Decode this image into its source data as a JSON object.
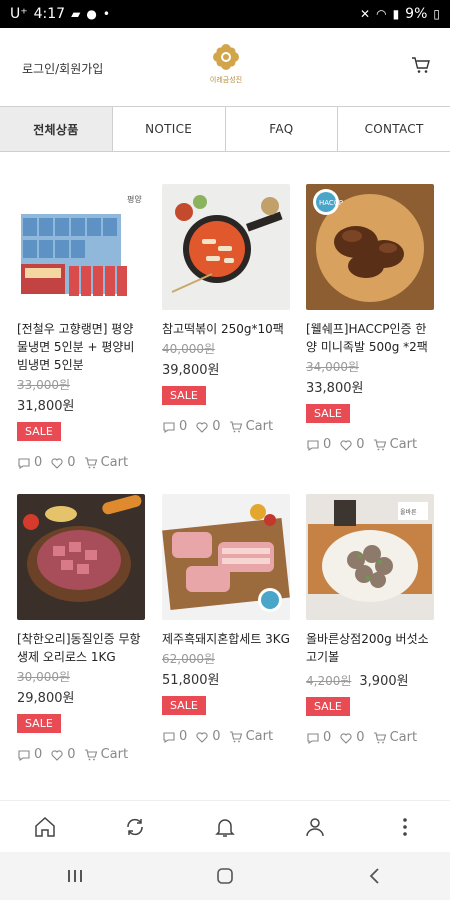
{
  "status_bar": {
    "carrier": "U⁺",
    "time": "4:17",
    "battery": "9%"
  },
  "header": {
    "login_label": "로그인/회원가입",
    "logo_text": "이레금성진"
  },
  "tabs": [
    {
      "label": "전체상품",
      "active": true
    },
    {
      "label": "NOTICE",
      "active": false
    },
    {
      "label": "FAQ",
      "active": false
    },
    {
      "label": "CONTACT",
      "active": false
    }
  ],
  "products": [
    {
      "name": "[전철우 고향랭면] 평양 물냉면 5인분 + 평양비빔냉면 5인분",
      "old_price": "33,000원",
      "price": "31,800원",
      "sale": "SALE",
      "comments": "0",
      "likes": "0",
      "cart": "Cart"
    },
    {
      "name": "참고떡볶이 250g*10팩",
      "old_price": "40,000원",
      "price": "39,800원",
      "sale": "SALE",
      "comments": "0",
      "likes": "0",
      "cart": "Cart"
    },
    {
      "name": "[웰쉐프]HACCP인증 한양 미니족발 500g *2팩",
      "old_price": "34,000원",
      "price": "33,800원",
      "sale": "SALE",
      "comments": "0",
      "likes": "0",
      "cart": "Cart"
    },
    {
      "name": "[착한오리]동질인증 무항생제 오리로스 1KG",
      "old_price": "30,000원",
      "price": "29,800원",
      "sale": "SALE",
      "comments": "0",
      "likes": "0",
      "cart": "Cart"
    },
    {
      "name": "제주흑돼지혼합세트 3KG",
      "old_price": "62,000원",
      "price": "51,800원",
      "sale": "SALE",
      "comments": "0",
      "likes": "0",
      "cart": "Cart"
    },
    {
      "name": "올바른상점200g 버섯소고기볼",
      "old_price": "4,200원",
      "price": "3,900원",
      "sale": "SALE",
      "comments": "0",
      "likes": "0",
      "cart": "Cart"
    }
  ],
  "icons": {
    "cart": "cart-icon",
    "home": "home-icon",
    "refresh": "refresh-icon",
    "bell": "bell-icon",
    "user": "user-icon",
    "more": "more-vertical-icon",
    "comment": "comment-icon",
    "heart": "heart-icon"
  },
  "colors": {
    "sale": "#e94b55",
    "active_tab": "#ececec"
  }
}
